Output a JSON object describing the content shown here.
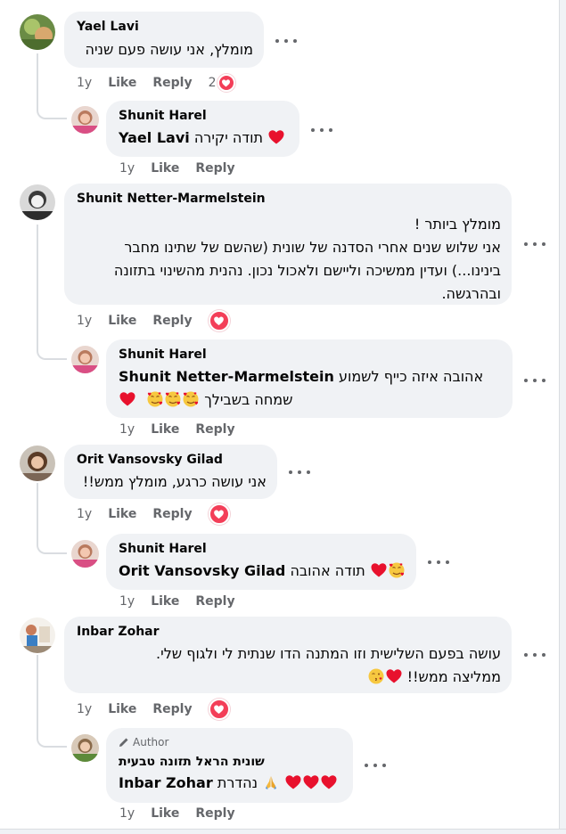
{
  "comments": [
    {
      "author": "Yael Lavi",
      "text": "מומלץ, אני עושה פעם שניה",
      "age": "1y",
      "like": "Like",
      "reply": "Reply",
      "reaction_count": "2",
      "reply_item": {
        "author": "Shunit Harel",
        "mention": "Yael Lavi",
        "text": "תודה יקירה",
        "age": "1y",
        "like": "Like",
        "reply": "Reply"
      }
    },
    {
      "author": "Shunit Netter-Marmelstein",
      "lines": [
        "מומלץ ביותר !",
        "אני שלוש שנים אחרי הסדנה של שונית (שהשם של שתינו מחבר",
        "בינינו...) ועדין ממשיכה וליישם ולאכול נכון. נהנית מהשינוי בתזונה",
        "ובהרגשה."
      ],
      "age": "1y",
      "like": "Like",
      "reply": "Reply",
      "reply_item": {
        "author": "Shunit Harel",
        "mention": "Shunit Netter-Marmelstein",
        "text": "אהובה איזה כייף לשמוע",
        "text2": "שמחה בשבילך",
        "age": "1y",
        "like": "Like",
        "reply": "Reply"
      }
    },
    {
      "author": "Orit Vansovsky Gilad",
      "text": "אני עושה כרגע, מומלץ ממש!!",
      "age": "1y",
      "like": "Like",
      "reply": "Reply",
      "reply_item": {
        "author": "Shunit Harel",
        "mention": "Orit Vansovsky Gilad",
        "text": "תודה אהובה",
        "age": "1y",
        "like": "Like",
        "reply": "Reply"
      }
    },
    {
      "author": "Inbar Zohar",
      "lines": [
        "עושה בפעם השלישית וזו המתנה הדו שנתית לי ולגוף שלי.",
        "ממליצה ממש!!"
      ],
      "age": "1y",
      "like": "Like",
      "reply": "Reply",
      "reply_item": {
        "badge": "Author",
        "author": "שונית הראל תזונה טבעית",
        "mention": "Inbar Zohar",
        "text": "נהדרת",
        "age": "1y",
        "like": "Like",
        "reply": "Reply"
      }
    }
  ],
  "colors": {
    "heart": "#f33e58",
    "bubble": "#f0f2f5",
    "meta": "#65676b"
  },
  "icons": [
    "heart-reaction-icon",
    "more-options-icon",
    "pencil-icon",
    "smiling-hearts-emoji",
    "red-heart-emoji",
    "praying-hands-emoji",
    "kiss-emoji"
  ]
}
